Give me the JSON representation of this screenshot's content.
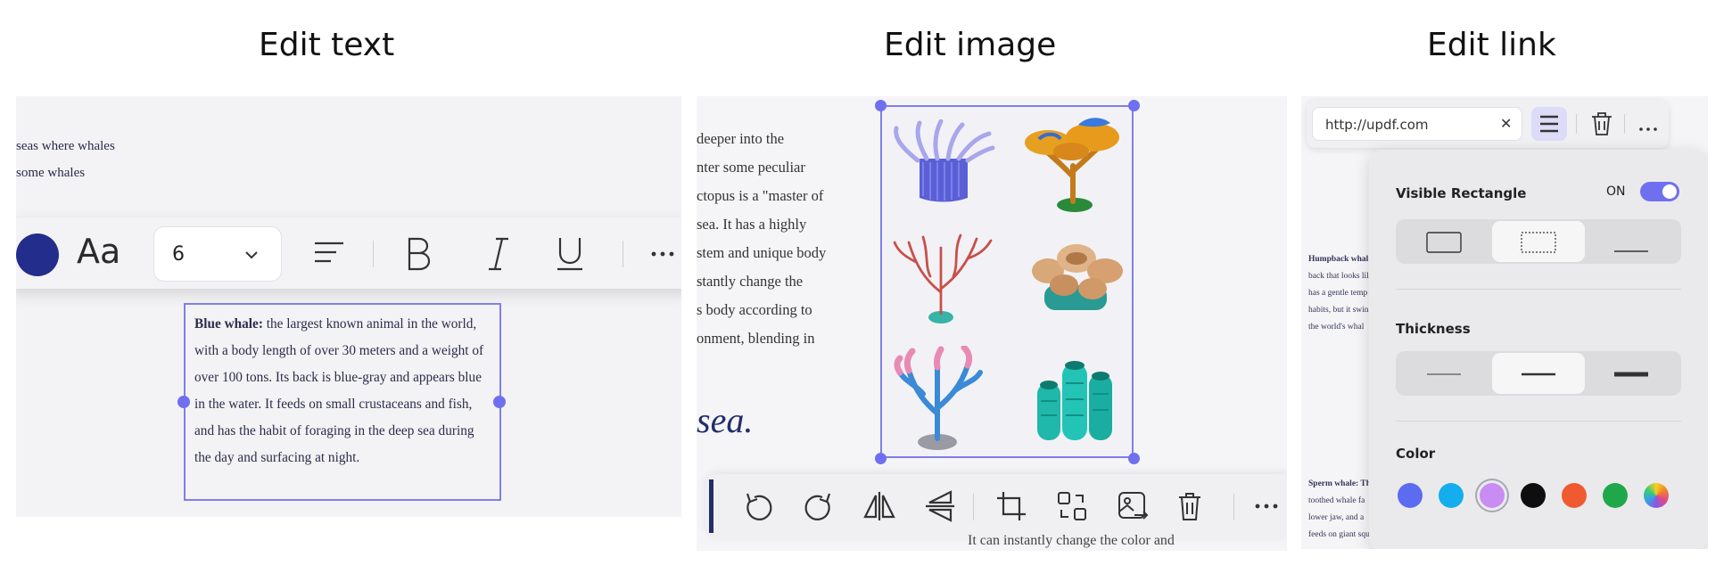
{
  "titles": {
    "edit_text": "Edit text",
    "edit_image": "Edit image",
    "edit_link": "Edit link"
  },
  "edit_text": {
    "doc_lines": [
      "seas where whales",
      "some whales"
    ],
    "font_size": "6",
    "aa_label": "Aa",
    "text_box": {
      "bold_lead": "Blue whale:",
      "body": " the largest known animal in the world, with a body length of over 30 meters and a weight of over 100 tons. Its back is blue-gray and appears blue in the water. It feeds on small crustaceans and fish, and has the habit of foraging in the deep sea during the day and surfacing at night."
    },
    "colors": {
      "text_color": "#232d8b",
      "accent": "#6f70f0"
    }
  },
  "edit_image": {
    "doc_lines": [
      "deeper into the",
      "nter some peculiar",
      "ctopus is a \"master of",
      "sea. It has a highly",
      "stem and unique body",
      "stantly change the",
      "s body according to",
      "onment, blending in"
    ],
    "big_text": "sea.",
    "bottom_text": "It can instantly change the color and"
  },
  "edit_link": {
    "url": "http://updf.com",
    "doc_bits": {
      "humpback": [
        "Humpback whal",
        "back that looks lil",
        "has a gentle temp",
        "habits, but it swin",
        "the world's whal"
      ],
      "sperm": [
        "Sperm whale: Th",
        "toothed whale fa",
        "lower jaw, and a",
        "feeds on giant squ"
      ]
    },
    "popup": {
      "visible_rect_label": "Visible Rectangle",
      "toggle_state": "ON",
      "thickness_label": "Thickness",
      "color_label": "Color",
      "colors": [
        "#5b6cf0",
        "#14aeee",
        "#c98cf2",
        "#0e0e0e",
        "#f05a30",
        "#1fa84a",
        "rainbow"
      ],
      "selected_color": "#c98cf2"
    }
  }
}
